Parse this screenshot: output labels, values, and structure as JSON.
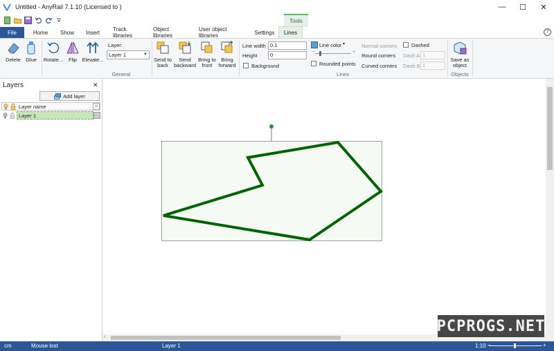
{
  "window": {
    "title": "Untitled - AnyRail 7.1.10 (Licensed to )",
    "controls": {
      "minimize": "—",
      "maximize": "☐",
      "close": "✕"
    }
  },
  "contextual_tab_header": "Tools",
  "tabs": [
    {
      "label": "File"
    },
    {
      "label": "Home"
    },
    {
      "label": "Show"
    },
    {
      "label": "Insert"
    },
    {
      "label": "Track libraries"
    },
    {
      "label": "Object libraries"
    },
    {
      "label": "User object libraries"
    },
    {
      "label": "Settings"
    },
    {
      "label": "Lines"
    }
  ],
  "ribbon": {
    "general": {
      "buttons": [
        "Delete",
        "Glue",
        "Rotate...",
        "Flip",
        "Elevate..."
      ],
      "layer_label": "Layer:",
      "layer_value": "Layer 1",
      "order_buttons": [
        {
          "line1": "Send to",
          "line2": "back"
        },
        {
          "line1": "Send",
          "line2": "backward"
        },
        {
          "line1": "Bring to",
          "line2": "front"
        },
        {
          "line1": "Bring",
          "line2": "forward"
        }
      ],
      "group_label": "General"
    },
    "lines": {
      "line_width_label": "Line width",
      "line_width_value": "0.1",
      "height_label": "Height",
      "height_value": "0",
      "background_label": "Background",
      "line_color_label": "Line color",
      "rounded_points_label": "Rounded points",
      "normal_corners_label": "Normal corners",
      "round_corners_label": "Round corners",
      "curved_corners_label": "Curved corners",
      "dashed_label": "Dashed",
      "dash_a_label": "Dash A",
      "dash_a_value": "1",
      "dash_b_label": "Dash B",
      "dash_b_value": "1",
      "group_label": "Lines"
    },
    "objects": {
      "save_line1": "Save as",
      "save_line2": "object",
      "group_label": "Objects"
    }
  },
  "layers_panel": {
    "title": "Layers",
    "close": "✕",
    "add_button": "Add layer",
    "column_header": "Layer name",
    "rows": [
      {
        "name": "Layer 1"
      }
    ]
  },
  "statusbar": {
    "unit": "cm",
    "mouse": "Mouse lost",
    "layer": "Layer 1",
    "scale": "1:10",
    "zoom_out": "−",
    "zoom_in": "+"
  },
  "watermark": "PCPROGS.NET",
  "colors": {
    "accent": "#2b579a",
    "shape_stroke": "#006400",
    "selection_box": "#f5faf4",
    "selection_border": "#9aa59a",
    "context_tab": "#e3f1e6"
  }
}
